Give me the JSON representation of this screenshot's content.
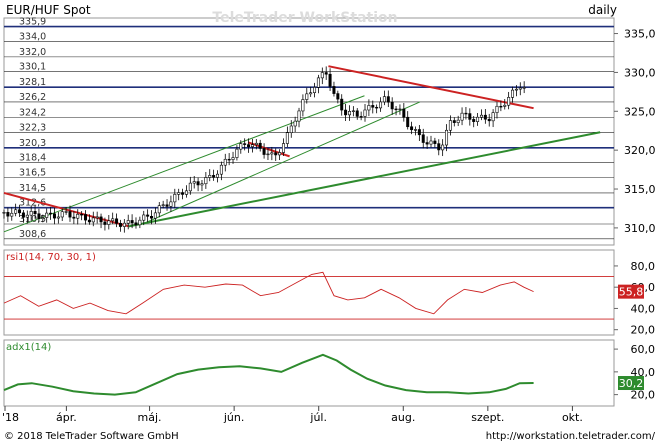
{
  "header": {
    "title": "EUR/HUF Spot",
    "watermark": "TeleTrader WorkStation",
    "period": "daily"
  },
  "footer": {
    "copyright": "© 2018 TeleTrader Software GmbH",
    "url": "http://workstation.teletrader.com/"
  },
  "chart_data": [
    {
      "type": "candlestick",
      "title": "EUR/HUF Spot",
      "ylim": [
        307.8,
        337.0
      ],
      "y_ticks": [
        310.0,
        315.0,
        320.0,
        325.0,
        330.0,
        335.0
      ],
      "y_tick_labels": [
        "310,0",
        "315,0",
        "320,0",
        "325,0",
        "330,0",
        "335,0"
      ],
      "x_ticks": [
        "'18",
        "ápr.",
        "máj.",
        "jún.",
        "júl.",
        "aug.",
        "szept.",
        "okt."
      ],
      "x_tick_days": [
        0,
        45,
        105,
        166,
        227,
        288,
        349,
        410
      ],
      "grid": "horizontal level lines",
      "levels": [
        {
          "value": 335.9,
          "label": "335,9",
          "strong": true
        },
        {
          "value": 334.0,
          "label": "334,0",
          "strong": false
        },
        {
          "value": 332.0,
          "label": "332,0",
          "strong": false
        },
        {
          "value": 330.1,
          "label": "330,1",
          "strong": false
        },
        {
          "value": 328.1,
          "label": "328,1",
          "strong": true
        },
        {
          "value": 326.2,
          "label": "326,2",
          "strong": false
        },
        {
          "value": 324.2,
          "label": "324,2",
          "strong": false
        },
        {
          "value": 322.3,
          "label": "322,3",
          "strong": false
        },
        {
          "value": 320.3,
          "label": "320,3",
          "strong": true
        },
        {
          "value": 318.4,
          "label": "318,4",
          "strong": false
        },
        {
          "value": 316.5,
          "label": "316,5",
          "strong": false
        },
        {
          "value": 314.5,
          "label": "314,5",
          "strong": false
        },
        {
          "value": 312.6,
          "label": "312,6",
          "strong": true
        },
        {
          "value": 310.5,
          "label": "310,5",
          "strong": false
        },
        {
          "value": 308.6,
          "label": "308,6",
          "strong": false
        }
      ],
      "trendlines": [
        {
          "color": "#cc2222",
          "width": 2,
          "from": {
            "day": 0,
            "value": 314.5
          },
          "to": {
            "day": 90,
            "value": 310.2
          }
        },
        {
          "color": "#cc2222",
          "width": 2,
          "from": {
            "day": 176,
            "value": 321.0
          },
          "to": {
            "day": 206,
            "value": 319.2
          }
        },
        {
          "color": "#cc2222",
          "width": 2,
          "from": {
            "day": 234,
            "value": 330.8
          },
          "to": {
            "day": 382,
            "value": 325.4
          }
        },
        {
          "color": "#2e8b2e",
          "width": 2,
          "from": {
            "day": 90,
            "value": 310.2
          },
          "to": {
            "day": 430,
            "value": 322.3
          }
        },
        {
          "color": "#2e8b2e",
          "width": 1,
          "from": {
            "day": 0,
            "value": 309.5
          },
          "to": {
            "day": 260,
            "value": 327.0
          }
        },
        {
          "color": "#2e8b2e",
          "width": 1,
          "from": {
            "day": 100,
            "value": 310.5
          },
          "to": {
            "day": 300,
            "value": 326.2
          }
        }
      ],
      "series": [
        {
          "points": [
            {
              "day": 0,
              "value": 312.0
            },
            {
              "day": 15,
              "value": 311.8
            },
            {
              "day": 30,
              "value": 311.5
            },
            {
              "day": 45,
              "value": 311.8
            },
            {
              "day": 60,
              "value": 311.2
            },
            {
              "day": 75,
              "value": 310.8
            },
            {
              "day": 90,
              "value": 310.5
            },
            {
              "day": 105,
              "value": 311.5
            },
            {
              "day": 120,
              "value": 313.5
            },
            {
              "day": 135,
              "value": 315.5
            },
            {
              "day": 150,
              "value": 316.5
            },
            {
              "day": 160,
              "value": 318.5
            },
            {
              "day": 168,
              "value": 320.0
            },
            {
              "day": 175,
              "value": 321.0
            },
            {
              "day": 185,
              "value": 320.2
            },
            {
              "day": 195,
              "value": 319.0
            },
            {
              "day": 205,
              "value": 322.0
            },
            {
              "day": 212,
              "value": 325.0
            },
            {
              "day": 220,
              "value": 327.5
            },
            {
              "day": 227,
              "value": 329.0
            },
            {
              "day": 232,
              "value": 330.3
            },
            {
              "day": 238,
              "value": 327.0
            },
            {
              "day": 245,
              "value": 325.0
            },
            {
              "day": 255,
              "value": 324.5
            },
            {
              "day": 265,
              "value": 325.5
            },
            {
              "day": 275,
              "value": 326.5
            },
            {
              "day": 285,
              "value": 325.0
            },
            {
              "day": 295,
              "value": 322.5
            },
            {
              "day": 305,
              "value": 321.0
            },
            {
              "day": 315,
              "value": 320.3
            },
            {
              "day": 322,
              "value": 323.5
            },
            {
              "day": 330,
              "value": 324.5
            },
            {
              "day": 340,
              "value": 324.0
            },
            {
              "day": 350,
              "value": 324.2
            },
            {
              "day": 360,
              "value": 326.0
            },
            {
              "day": 368,
              "value": 327.5
            },
            {
              "day": 374,
              "value": 328.8
            },
            {
              "day": 378,
              "value": 326.5
            }
          ]
        }
      ]
    },
    {
      "type": "line",
      "title": "rsi1(14, 70, 30, 1)",
      "ylim": [
        15,
        95
      ],
      "y_ticks": [
        20.0,
        40.0,
        60.0,
        80.0
      ],
      "y_tick_labels": [
        "20,0",
        "40,0",
        "60,0",
        "80,0"
      ],
      "reference_lines": [
        70,
        30
      ],
      "last_value_label": "55,8",
      "series": [
        {
          "color": "#cc2222",
          "points": [
            {
              "day": 0,
              "value": 45
            },
            {
              "day": 12,
              "value": 52
            },
            {
              "day": 25,
              "value": 42
            },
            {
              "day": 38,
              "value": 48
            },
            {
              "day": 50,
              "value": 40
            },
            {
              "day": 62,
              "value": 45
            },
            {
              "day": 75,
              "value": 38
            },
            {
              "day": 88,
              "value": 35
            },
            {
              "day": 100,
              "value": 45
            },
            {
              "day": 115,
              "value": 58
            },
            {
              "day": 130,
              "value": 62
            },
            {
              "day": 145,
              "value": 60
            },
            {
              "day": 160,
              "value": 63
            },
            {
              "day": 172,
              "value": 62
            },
            {
              "day": 185,
              "value": 52
            },
            {
              "day": 198,
              "value": 55
            },
            {
              "day": 212,
              "value": 65
            },
            {
              "day": 222,
              "value": 72
            },
            {
              "day": 230,
              "value": 74
            },
            {
              "day": 238,
              "value": 52
            },
            {
              "day": 248,
              "value": 48
            },
            {
              "day": 260,
              "value": 50
            },
            {
              "day": 272,
              "value": 58
            },
            {
              "day": 285,
              "value": 50
            },
            {
              "day": 297,
              "value": 40
            },
            {
              "day": 310,
              "value": 35
            },
            {
              "day": 320,
              "value": 48
            },
            {
              "day": 332,
              "value": 58
            },
            {
              "day": 345,
              "value": 55
            },
            {
              "day": 358,
              "value": 62
            },
            {
              "day": 368,
              "value": 65
            },
            {
              "day": 375,
              "value": 60
            },
            {
              "day": 382,
              "value": 55.8
            }
          ]
        }
      ]
    },
    {
      "type": "line",
      "title": "adx1(14)",
      "ylim": [
        10,
        68
      ],
      "y_ticks": [
        20.0,
        40.0,
        60.0
      ],
      "y_tick_labels": [
        "20,0",
        "40,0",
        "60,0"
      ],
      "last_value_label": "30,2",
      "series": [
        {
          "color": "#2e8b2e",
          "points": [
            {
              "day": 0,
              "value": 24
            },
            {
              "day": 10,
              "value": 29
            },
            {
              "day": 20,
              "value": 30
            },
            {
              "day": 35,
              "value": 27
            },
            {
              "day": 50,
              "value": 23
            },
            {
              "day": 65,
              "value": 21
            },
            {
              "day": 80,
              "value": 20
            },
            {
              "day": 95,
              "value": 22
            },
            {
              "day": 110,
              "value": 30
            },
            {
              "day": 125,
              "value": 38
            },
            {
              "day": 140,
              "value": 42
            },
            {
              "day": 155,
              "value": 44
            },
            {
              "day": 170,
              "value": 45
            },
            {
              "day": 185,
              "value": 43
            },
            {
              "day": 200,
              "value": 40
            },
            {
              "day": 215,
              "value": 48
            },
            {
              "day": 230,
              "value": 55
            },
            {
              "day": 240,
              "value": 50
            },
            {
              "day": 250,
              "value": 42
            },
            {
              "day": 262,
              "value": 34
            },
            {
              "day": 275,
              "value": 28
            },
            {
              "day": 290,
              "value": 24
            },
            {
              "day": 305,
              "value": 22
            },
            {
              "day": 320,
              "value": 22
            },
            {
              "day": 335,
              "value": 21
            },
            {
              "day": 350,
              "value": 22
            },
            {
              "day": 362,
              "value": 25
            },
            {
              "day": 372,
              "value": 30
            },
            {
              "day": 382,
              "value": 30.2
            }
          ]
        }
      ]
    }
  ]
}
